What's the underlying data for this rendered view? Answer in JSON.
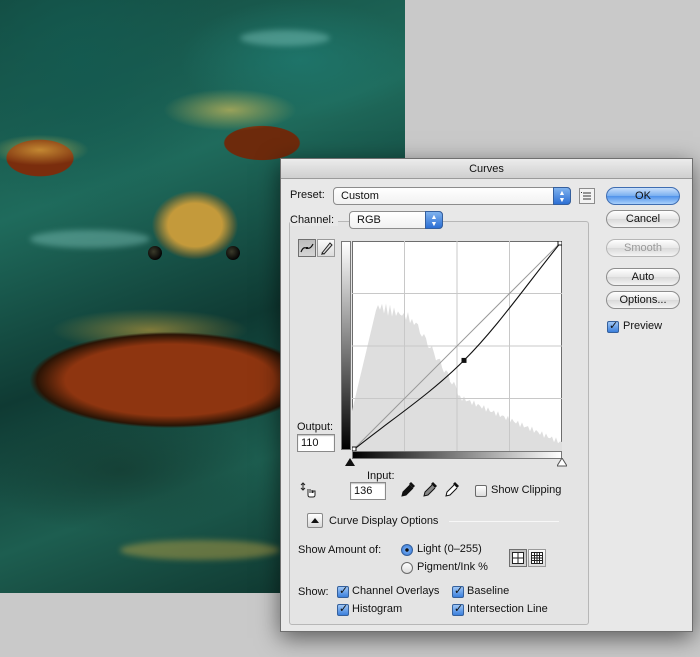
{
  "dialog": {
    "title": "Curves"
  },
  "preset": {
    "label": "Preset:",
    "value": "Custom"
  },
  "channel": {
    "label": "Channel:",
    "value": "RGB"
  },
  "buttons": {
    "ok": "OK",
    "cancel": "Cancel",
    "smooth": "Smooth",
    "auto": "Auto",
    "options": "Options..."
  },
  "preview": {
    "label": "Preview",
    "checked": true
  },
  "output": {
    "label": "Output:",
    "value": "110"
  },
  "input": {
    "label": "Input:",
    "value": "136"
  },
  "show_clipping": {
    "label": "Show Clipping",
    "checked": false
  },
  "curve_display_options": {
    "label": "Curve Display Options"
  },
  "show_amount": {
    "label": "Show Amount of:",
    "options": [
      {
        "label": "Light  (0–255)",
        "selected": true
      },
      {
        "label": "Pigment/Ink %",
        "selected": false
      }
    ]
  },
  "show": {
    "label": "Show:",
    "items": [
      {
        "label": "Channel Overlays",
        "checked": true
      },
      {
        "label": "Baseline",
        "checked": true
      },
      {
        "label": "Histogram",
        "checked": true
      },
      {
        "label": "Intersection Line",
        "checked": true
      }
    ]
  },
  "curve": {
    "control_point": {
      "input": 136,
      "output": 110
    },
    "range": [
      0,
      255
    ]
  },
  "colors": {
    "accent": "#3b7fdc",
    "dialog_bg": "#e8e8e8"
  },
  "icons": [
    "curve-point-tool-icon",
    "pencil-tool-icon",
    "presets-menu-icon",
    "on-image-adjust-icon",
    "black-eyedropper-icon",
    "gray-eyedropper-icon",
    "white-eyedropper-icon",
    "disclosure-triangle-icon",
    "grid-4-icon",
    "grid-10-icon"
  ]
}
